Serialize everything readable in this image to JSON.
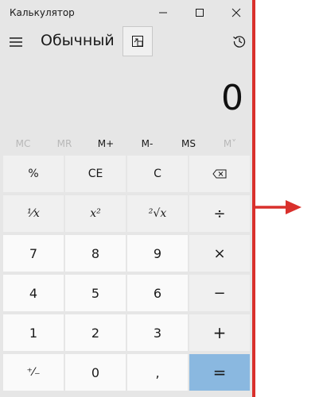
{
  "window": {
    "title": "Калькулятор",
    "minimize_icon": "minimize-icon",
    "maximize_icon": "maximize-icon",
    "close_icon": "close-icon"
  },
  "header": {
    "menu_icon": "hamburger-icon",
    "mode_title": "Обычный",
    "keep_on_top_icon": "keep-on-top-icon",
    "history_icon": "history-icon"
  },
  "display": {
    "value": "0"
  },
  "memory": [
    {
      "label": "MC",
      "enabled": false
    },
    {
      "label": "MR",
      "enabled": false
    },
    {
      "label": "M+",
      "enabled": true
    },
    {
      "label": "M-",
      "enabled": true
    },
    {
      "label": "MS",
      "enabled": true
    },
    {
      "label": "M˅",
      "enabled": false
    }
  ],
  "keys": {
    "percent": "%",
    "clear_entry": "CE",
    "clear": "C",
    "backspace_icon": "backspace-icon",
    "reciprocal": "¹⁄x",
    "square": "x²",
    "sqrt": "²√x",
    "divide": "÷",
    "seven": "7",
    "eight": "8",
    "nine": "9",
    "multiply": "×",
    "four": "4",
    "five": "5",
    "six": "6",
    "minus": "−",
    "one": "1",
    "two": "2",
    "three": "3",
    "plus": "+",
    "negate": "⁺⁄₋",
    "zero": "0",
    "decimal": ",",
    "equals": "="
  },
  "colors": {
    "annotation": "#d9302c",
    "equals_key": "#8ab8e0",
    "window_bg": "#e6e6e6"
  }
}
